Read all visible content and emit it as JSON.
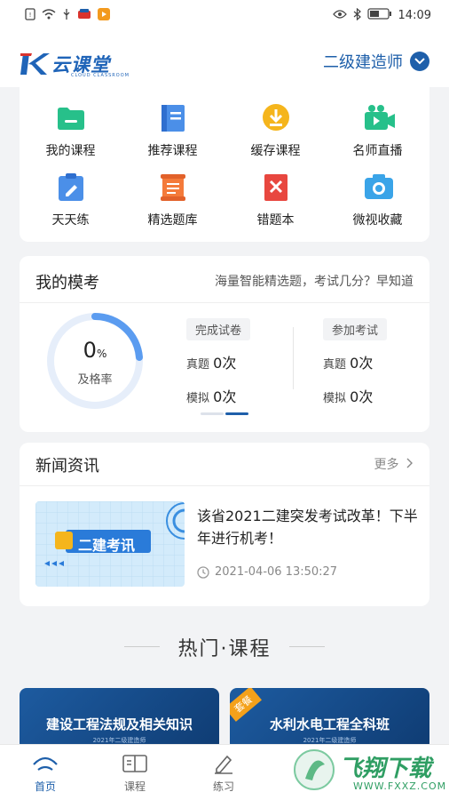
{
  "status_bar": {
    "time": "14:09"
  },
  "header": {
    "logo_text": "云课堂",
    "logo_sub": "CLOUD CLASSROOM",
    "exam_selected": "二级建造师"
  },
  "grid": [
    {
      "label": "我的课程"
    },
    {
      "label": "推荐课程"
    },
    {
      "label": "缓存课程"
    },
    {
      "label": "名师直播"
    },
    {
      "label": "天天练"
    },
    {
      "label": "精选题库"
    },
    {
      "label": "错题本"
    },
    {
      "label": "微视收藏"
    }
  ],
  "mock": {
    "title": "我的模考",
    "subtitle": "海量智能精选题，考试几分？早知道",
    "pass_rate_value": "0",
    "pass_rate_unit": "%",
    "pass_rate_label": "及格率",
    "left_tag": "完成试卷",
    "right_tag": "参加考试",
    "left_real_label": "真题",
    "left_real_value": "0次",
    "left_mock_label": "模拟",
    "left_mock_value": "0次",
    "right_real_label": "真题",
    "right_real_value": "0次",
    "right_mock_label": "模拟",
    "right_mock_value": "0次"
  },
  "news": {
    "title": "新闻资讯",
    "more": "更多",
    "item_headline": "该省2021二建突发考试改革！下半年进行机考！",
    "item_time": "2021-04-06 13:50:27",
    "thumb_text": "二建考讯"
  },
  "hot": {
    "title": "热门·课程"
  },
  "courses": [
    {
      "name": "建设工程法规及相关知识",
      "sub": "2021年二级建造师"
    },
    {
      "name": "水利水电工程全科班",
      "sub": "2021年二级建造师",
      "tag": "套餐"
    }
  ],
  "tabs": [
    {
      "label": "首页"
    },
    {
      "label": "课程"
    },
    {
      "label": "练习"
    }
  ],
  "watermark": {
    "text": "飞翔下载",
    "url": "WWW.FXXZ.COM"
  },
  "colors": {
    "brand": "#1e5faa",
    "background": "#f2f3f5"
  }
}
